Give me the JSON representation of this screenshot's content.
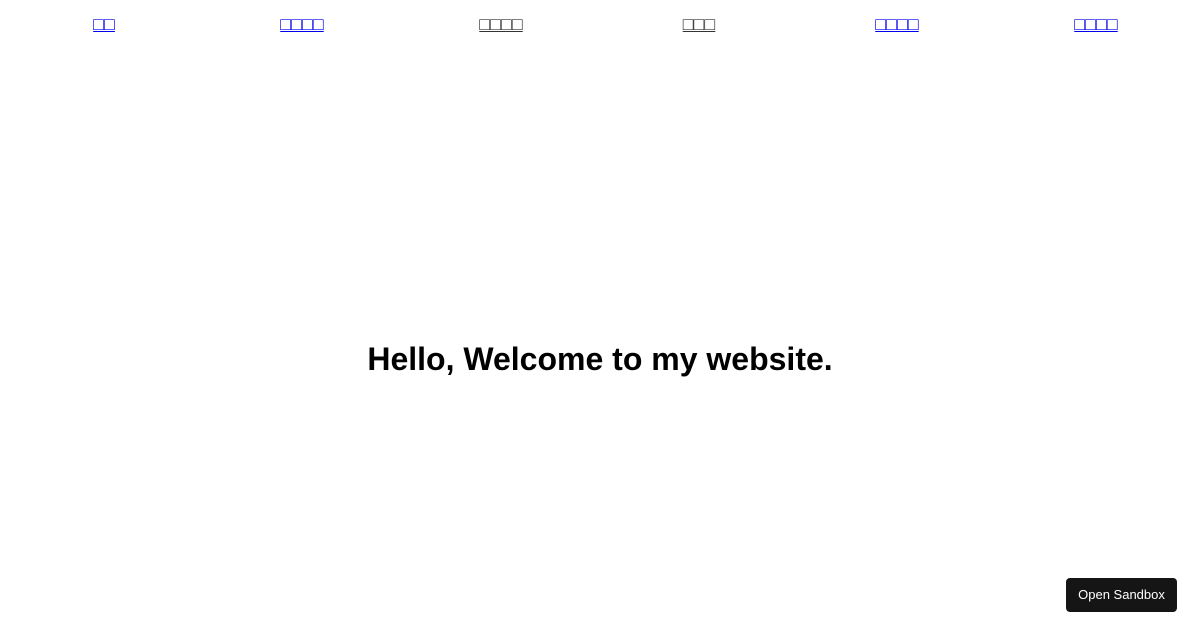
{
  "nav": {
    "links": [
      {
        "label": "□□"
      },
      {
        "label": "□□□□"
      },
      {
        "label": "□□□□"
      },
      {
        "label": "□□□"
      },
      {
        "label": "□□□□"
      },
      {
        "label": "□□□□"
      }
    ]
  },
  "main": {
    "heading": "Hello, Welcome to my website."
  },
  "sandbox": {
    "button_label": "Open Sandbox"
  },
  "colors": {
    "link": "#0000ee",
    "visited_link": "#333333",
    "button_bg": "#151515",
    "button_text": "#ffffff"
  }
}
